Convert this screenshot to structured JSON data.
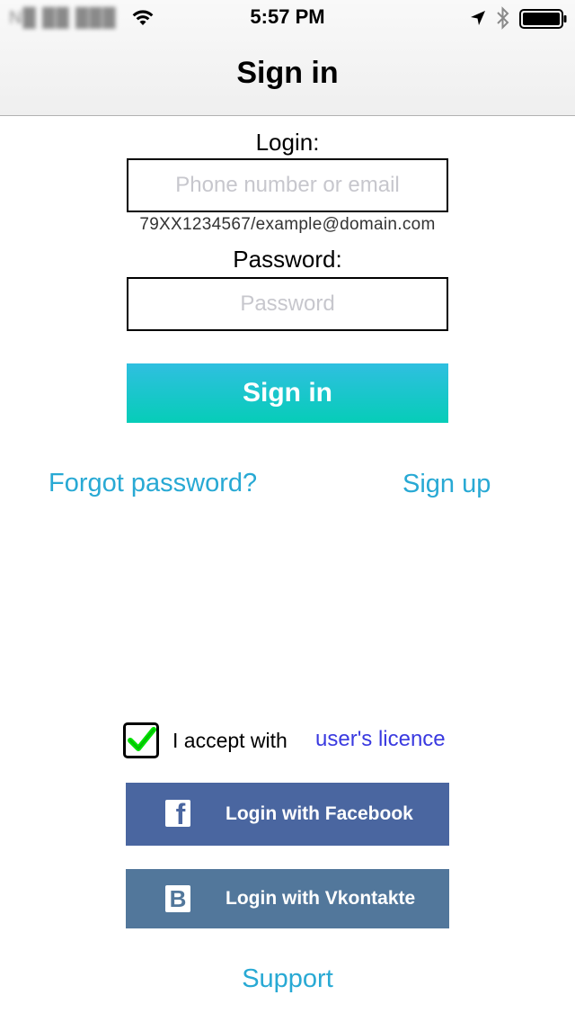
{
  "status_bar": {
    "carrier": "N█ ██ ███",
    "time": "5:57 PM"
  },
  "nav": {
    "title": "Sign in"
  },
  "form": {
    "login_label": "Login:",
    "login_placeholder": "Phone number or email",
    "login_value": "",
    "login_hint": "79XX1234567/example@domain.com",
    "password_label": "Password:",
    "password_placeholder": "Password",
    "password_value": "",
    "signin_label": "Sign in"
  },
  "links": {
    "forgot_password": "Forgot password?",
    "sign_up": "Sign up",
    "support": "Support"
  },
  "licence": {
    "checked": true,
    "accept_text": "I accept with",
    "link_text": "user's licence"
  },
  "social": {
    "facebook_label": "Login with Facebook",
    "facebook_icon_glyph": "f",
    "vkontakte_label": "Login with Vkontakte",
    "vkontakte_icon_glyph": "B"
  },
  "colors": {
    "accent_link": "#28a9d4",
    "licence_link": "#3a3ae0",
    "signin_gradient_top": "#2fbfe0",
    "signin_gradient_bottom": "#06cdb8",
    "facebook": "#4a66a0",
    "vkontakte": "#52779b",
    "check_green": "#00e000"
  }
}
